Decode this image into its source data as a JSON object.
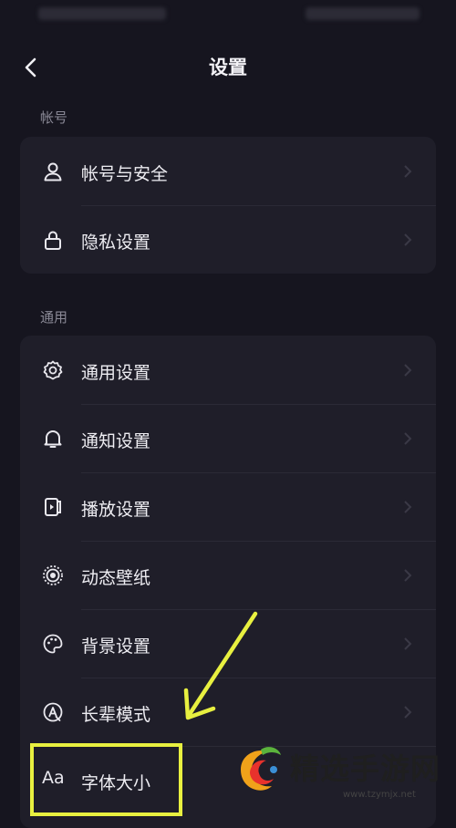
{
  "header": {
    "title": "设置"
  },
  "sections": [
    {
      "label": "帐号",
      "items": [
        {
          "label": "帐号与安全",
          "icon": "user-icon"
        },
        {
          "label": "隐私设置",
          "icon": "lock-icon"
        }
      ]
    },
    {
      "label": "通用",
      "items": [
        {
          "label": "通用设置",
          "icon": "gear-icon"
        },
        {
          "label": "通知设置",
          "icon": "bell-icon"
        },
        {
          "label": "播放设置",
          "icon": "play-device-icon"
        },
        {
          "label": "动态壁纸",
          "icon": "wallpaper-icon"
        },
        {
          "label": "背景设置",
          "icon": "palette-icon"
        },
        {
          "label": "长辈模式",
          "icon": "elder-mode-icon"
        },
        {
          "label": "字体大小",
          "icon_text": "Aa",
          "icon": "font-size-icon"
        }
      ]
    }
  ],
  "watermark": {
    "text": "精选手游网",
    "url": "www.tzymjx.net"
  },
  "colors": {
    "background": "#16151f",
    "card": "#1f1e29",
    "highlight": "#e8f040",
    "muted": "#8a8996"
  }
}
